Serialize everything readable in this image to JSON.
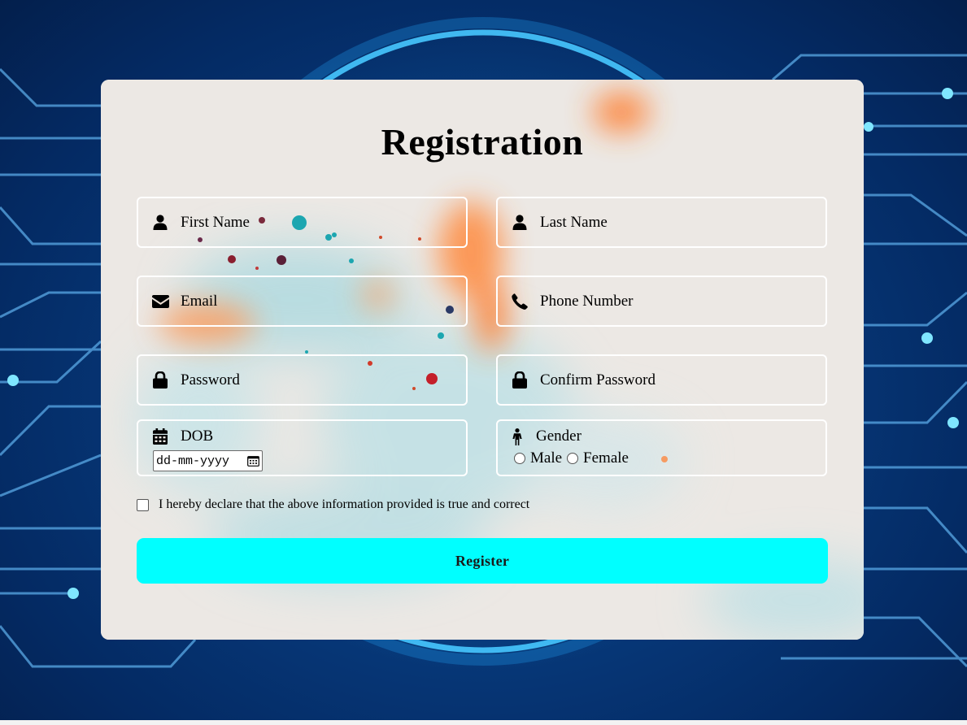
{
  "form": {
    "title": "Registration",
    "fields": {
      "first_name": "First Name",
      "last_name": "Last Name",
      "email": "Email",
      "phone": "Phone Number",
      "password": "Password",
      "confirm_password": "Confirm Password",
      "dob_label": "DOB",
      "dob_placeholder": "dd-mm-yyyy",
      "gender_label": "Gender",
      "gender_options": [
        "Male",
        "Female"
      ]
    },
    "declaration": "I hereby declare that the above information provided is true and correct",
    "submit_label": "Register"
  },
  "icons": {
    "first_name": "user-icon",
    "last_name": "user-icon",
    "email": "envelope-icon",
    "phone": "phone-icon",
    "password": "lock-icon",
    "confirm_password": "lock-icon",
    "dob": "calendar-icon",
    "gender": "person-icon",
    "date_picker": "calendar-picker-icon"
  },
  "colors": {
    "accent_button": "#00ffff",
    "background": "#073a7c",
    "circuit_glow": "#3fd6ff",
    "field_border": "#ffffff"
  }
}
